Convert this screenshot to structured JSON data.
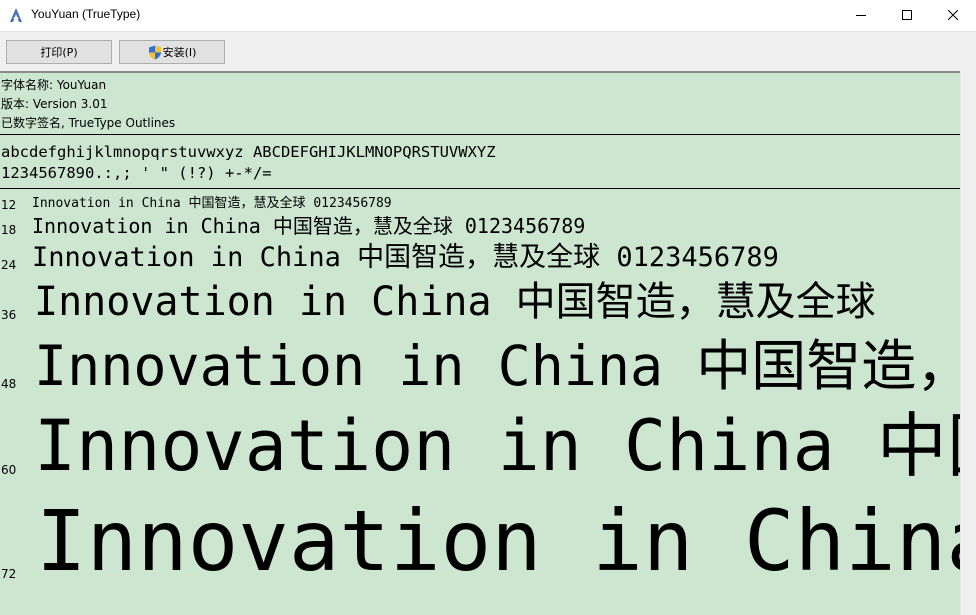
{
  "window": {
    "title": "YouYuan (TrueType)",
    "icon": "font-icon"
  },
  "toolbar": {
    "print_label": "打印(P)",
    "install_label": "安装(I)"
  },
  "font_info": {
    "name_line": "字体名称: YouYuan",
    "version_line": "版本: Version 3.01",
    "signature_line": "已数字签名, TrueType Outlines"
  },
  "charset": {
    "letters": "abcdefghijklmnopqrstuvwxyz ABCDEFGHIJKLMNOPQRSTUVWXYZ",
    "digits_symbols": "1234567890.:,; ' \" (!?) +-*/="
  },
  "samples": [
    {
      "size": "12",
      "text": "Innovation in China 中国智造，慧及全球 0123456789"
    },
    {
      "size": "18",
      "text": "Innovation in China 中国智造，慧及全球 0123456789"
    },
    {
      "size": "24",
      "text": "Innovation in China 中国智造，慧及全球 0123456789"
    },
    {
      "size": "36",
      "text": "Innovation in China 中国智造，慧及全球"
    },
    {
      "size": "48",
      "text": "Innovation in China 中国智造，"
    },
    {
      "size": "60",
      "text": "Innovation in China 中国"
    },
    {
      "size": "72",
      "text": "Innovation in China"
    }
  ],
  "colors": {
    "preview_background": "#cde6d0",
    "toolbar_background": "#f0f0f0"
  }
}
